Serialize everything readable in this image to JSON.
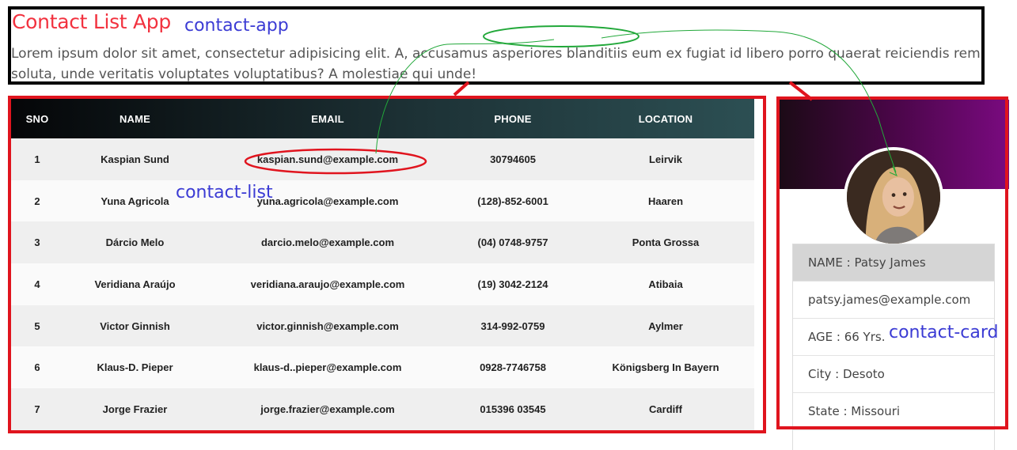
{
  "app": {
    "title": "Contact List App",
    "description": "Lorem ipsum dolor sit amet, consectetur adipisicing elit. A, accusamus asperiores blanditiis eum ex fugiat id libero porro quaerat reiciendis rem soluta, unde veritatis voluptates voluptatibus? A molestiae qui unde!"
  },
  "annotations": {
    "app_label": "contact-app",
    "list_label": "contact-list",
    "card_label": "contact-card"
  },
  "table": {
    "columns": [
      "SNO",
      "NAME",
      "EMAIL",
      "PHONE",
      "LOCATION"
    ],
    "rows": [
      [
        "1",
        "Kaspian Sund",
        "kaspian.sund@example.com",
        "30794605",
        "Leirvik"
      ],
      [
        "2",
        "Yuna Agricola",
        "yuna.agricola@example.com",
        "(128)-852-6001",
        "Haaren"
      ],
      [
        "3",
        "Dárcio Melo",
        "darcio.melo@example.com",
        "(04) 0748-9757",
        "Ponta Grossa"
      ],
      [
        "4",
        "Veridiana Araújo",
        "veridiana.araujo@example.com",
        "(19) 3042-2124",
        "Atibaia"
      ],
      [
        "5",
        "Victor Ginnish",
        "victor.ginnish@example.com",
        "314-992-0759",
        "Aylmer"
      ],
      [
        "6",
        "Klaus-D. Pieper",
        "klaus-d..pieper@example.com",
        "0928-7746758",
        "Königsberg In Bayern"
      ],
      [
        "7",
        "Jorge Frazier",
        "jorge.frazier@example.com",
        "015396 03545",
        "Cardiff"
      ]
    ]
  },
  "card": {
    "name": "NAME : Patsy James",
    "email": "patsy.james@example.com",
    "age": "AGE : 66 Yrs.",
    "city": "City : Desoto",
    "state": "State : Missouri"
  },
  "colors": {
    "title": "#f2323f",
    "annotation_text": "#3b3bd4",
    "annotation_box": "#e0141e",
    "banner": "#7a0a80"
  }
}
